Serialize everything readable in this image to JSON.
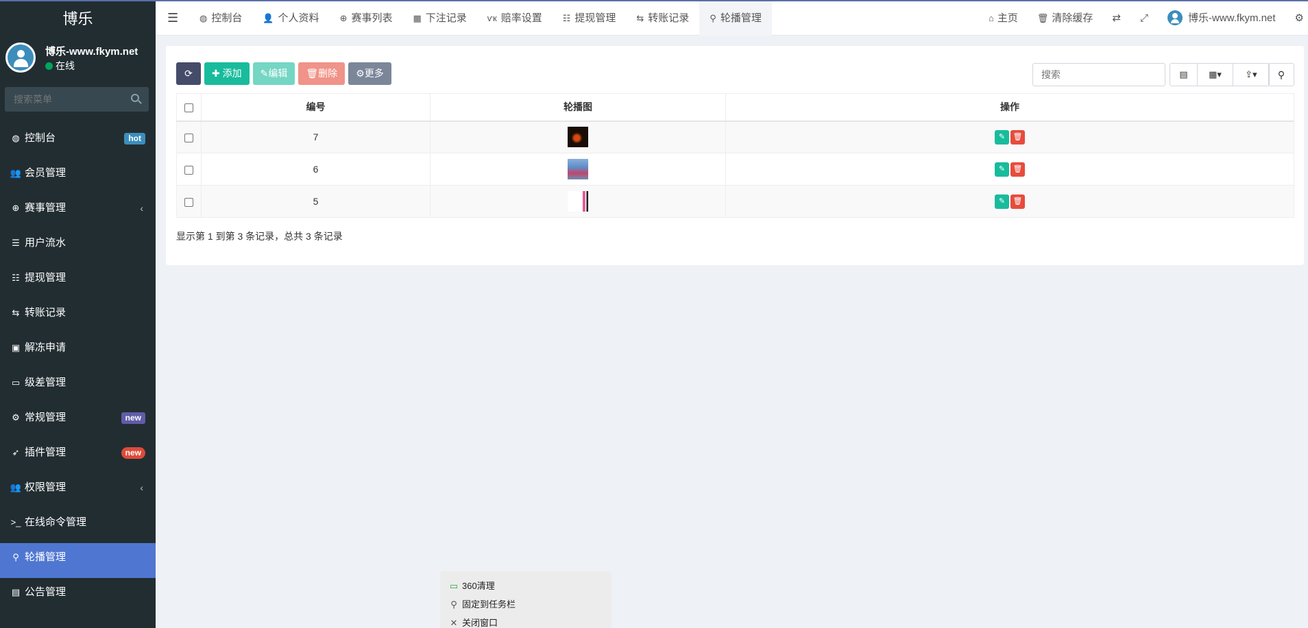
{
  "brand": "博乐",
  "user": {
    "name": "博乐-www.fkym.net",
    "status": "在线"
  },
  "sidebar": {
    "search_placeholder": "搜索菜单",
    "items": [
      {
        "label": "控制台",
        "icon": "dashboard-icon",
        "badge": "hot"
      },
      {
        "label": "会员管理",
        "icon": "users-icon"
      },
      {
        "label": "赛事管理",
        "icon": "lifebuoy-icon",
        "arrow": "‹"
      },
      {
        "label": "用户流水",
        "icon": "list-icon"
      },
      {
        "label": "提现管理",
        "icon": "list-alt-icon"
      },
      {
        "label": "转账记录",
        "icon": "transfer-icon"
      },
      {
        "label": "解冻申请",
        "icon": "image-icon"
      },
      {
        "label": "级差管理",
        "icon": "window-icon"
      },
      {
        "label": "常规管理",
        "icon": "cogs-icon",
        "badge": "new"
      },
      {
        "label": "插件管理",
        "icon": "rocket-icon",
        "badge": "new"
      },
      {
        "label": "权限管理",
        "icon": "group-icon",
        "arrow": "‹"
      },
      {
        "label": "在线命令管理",
        "icon": "terminal-icon"
      },
      {
        "label": "轮播管理",
        "icon": "carousel-icon",
        "active": true
      },
      {
        "label": "公告管理",
        "icon": "notice-icon"
      }
    ]
  },
  "navbar": {
    "tabs": [
      {
        "label": "控制台",
        "icon": "dashboard-icon"
      },
      {
        "label": "个人资料",
        "icon": "user-icon"
      },
      {
        "label": "赛事列表",
        "icon": "lifebuoy-icon"
      },
      {
        "label": "下注记录",
        "icon": "calendar-icon"
      },
      {
        "label": "赔率设置",
        "icon": "vk-icon"
      },
      {
        "label": "提现管理",
        "icon": "list-alt-icon"
      },
      {
        "label": "转账记录",
        "icon": "transfer-icon"
      },
      {
        "label": "轮播管理",
        "icon": "carousel-icon",
        "active": true
      }
    ],
    "right": {
      "home": "主页",
      "clear_cache": "清除缓存",
      "user_name": "博乐-www.fkym.net"
    }
  },
  "toolbar": {
    "add": "添加",
    "edit": "编辑",
    "delete": "删除",
    "more": "更多",
    "search_placeholder": "搜索"
  },
  "table": {
    "headers": [
      "编号",
      "轮播图",
      "操作"
    ],
    "rows": [
      {
        "id": "7",
        "thumb_colors": [
          "#1a0d05",
          "#d84a10"
        ]
      },
      {
        "id": "6",
        "thumb_colors": [
          "#5e8ec9",
          "#c2466b"
        ]
      },
      {
        "id": "5",
        "thumb_colors": [
          "#ffffff",
          "#e0106a"
        ]
      }
    ],
    "page_info": "显示第 1 到第 3 条记录，总共 3 条记录"
  },
  "context_menu": {
    "items": [
      "360清理",
      "固定到任务栏",
      "关闭窗口"
    ]
  }
}
